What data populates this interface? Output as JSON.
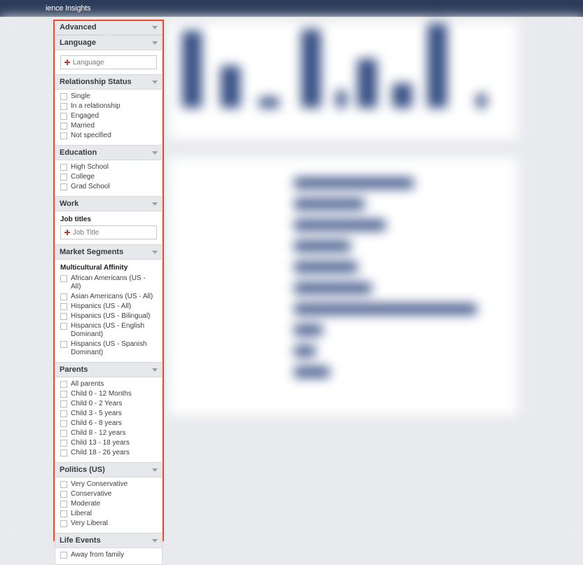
{
  "topbar_title": "ience Insights",
  "sections": {
    "advanced": {
      "title": "Advanced"
    },
    "language": {
      "title": "Language",
      "placeholder": "Language"
    },
    "relationship": {
      "title": "Relationship Status",
      "options": [
        "Single",
        "In a relationship",
        "Engaged",
        "Married",
        "Not specified"
      ]
    },
    "education": {
      "title": "Education",
      "options": [
        "High School",
        "College",
        "Grad School"
      ]
    },
    "work": {
      "title": "Work"
    },
    "job_titles": {
      "label": "Job titles",
      "placeholder": "Job Title"
    },
    "market_segments": {
      "title": "Market Segments"
    },
    "multicultural": {
      "label": "Multicultural Affinity",
      "options": [
        "African Americans (US - All)",
        "Asian Americans (US - All)",
        "Hispanics (US - All)",
        "Hispanics (US - Bilingual)",
        "Hispanics (US - English Dominant)",
        "Hispanics (US - Spanish Dominant)"
      ]
    },
    "parents": {
      "title": "Parents",
      "options": [
        "All parents",
        "Child 0 - 12 Months",
        "Child 0 - 2 Years",
        "Child 3 - 5 years",
        "Child 6 - 8 years",
        "Child 8 - 12 years",
        "Child 13 - 18 years",
        "Child 18 - 26 years"
      ]
    },
    "politics": {
      "title": "Politics (US)",
      "options": [
        "Very Conservative",
        "Conservative",
        "Moderate",
        "Liberal",
        "Very Liberal"
      ]
    },
    "life_events": {
      "title": "Life Events",
      "options": [
        "Away from family"
      ]
    }
  }
}
